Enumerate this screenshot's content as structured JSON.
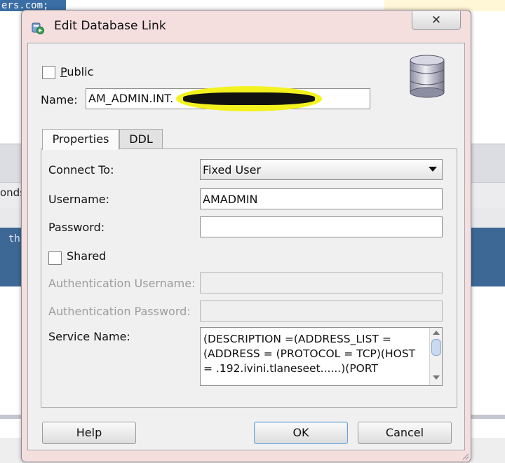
{
  "background": {
    "selected_text": "ers.com;",
    "partial_label": "onds",
    "code_fragment": "th"
  },
  "dialog": {
    "title": "Edit Database Link",
    "close_symbol": "✕",
    "public_label": "Public",
    "public_checked": false,
    "name_label": "Name:",
    "name_value": "AM_ADMIN.INT.",
    "tabs": [
      {
        "label": "Properties",
        "active": true
      },
      {
        "label": "DDL",
        "active": false
      }
    ],
    "properties": {
      "connect_to_label": "Connect To:",
      "connect_to_value": "Fixed User",
      "username_label": "Username:",
      "username_value": "AMADMIN",
      "password_label": "Password:",
      "password_value": "",
      "shared_label": "Shared",
      "shared_checked": false,
      "auth_username_label": "Authentication Username:",
      "auth_password_label": "Authentication Password:",
      "service_name_label": "Service Name:",
      "service_name_value": "(DESCRIPTION =(ADDRESS_LIST =(ADDRESS = (PROTOCOL = TCP)(HOST = .192.ivini.tlaneseet......)(PORT"
    },
    "buttons": {
      "help": "Help",
      "ok": "OK",
      "cancel": "Cancel"
    }
  },
  "colors": {
    "selection_blue": "#3a6ea5",
    "highlight_yellow": "#f3f21f",
    "dialog_frame": "#f4dede"
  },
  "icons": [
    "dialog-app-icon",
    "database-icon",
    "close-icon",
    "dropdown-arrow-icon"
  ]
}
